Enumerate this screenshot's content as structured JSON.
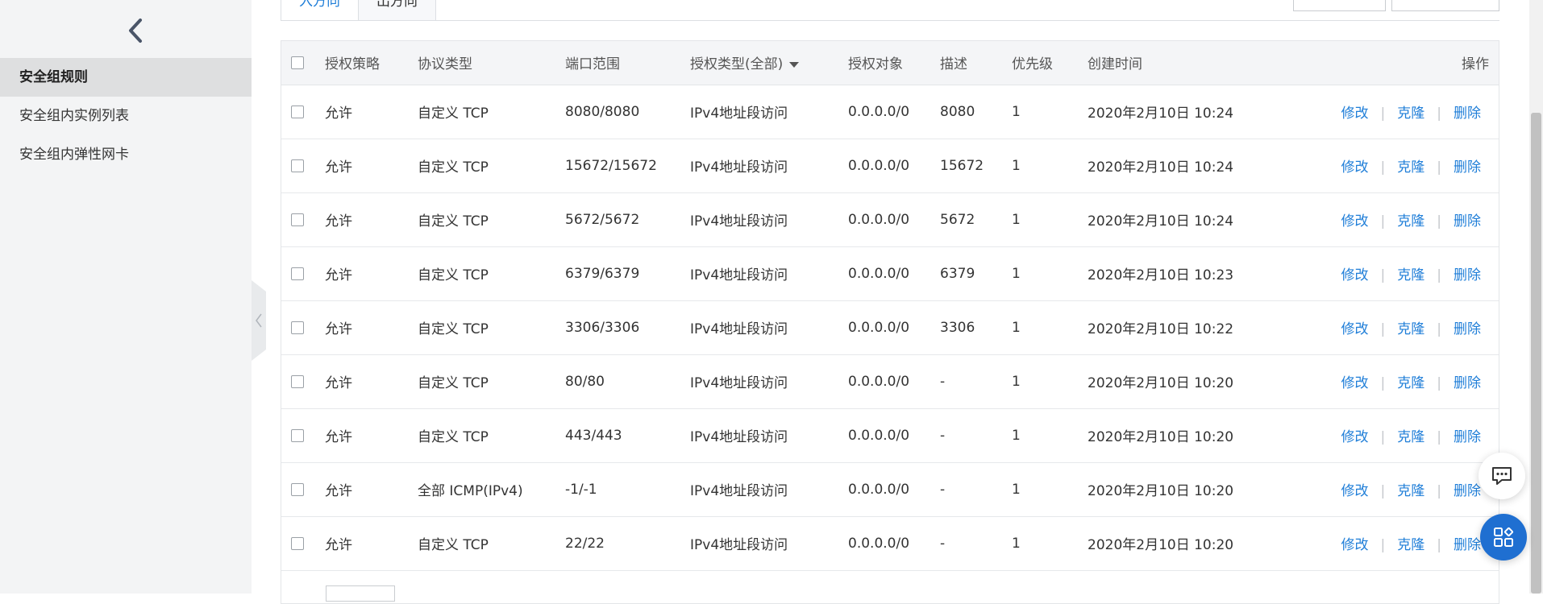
{
  "sidebar": {
    "items": [
      {
        "label": "安全组规则",
        "active": true
      },
      {
        "label": "安全组内实例列表",
        "active": false
      },
      {
        "label": "安全组内弹性网卡",
        "active": false
      }
    ]
  },
  "tabs": [
    {
      "label": "入方向"
    },
    {
      "label": "出方向"
    }
  ],
  "table": {
    "headers": {
      "policy": "授权策略",
      "protocol": "协议类型",
      "port": "端口范围",
      "auth_type": "授权类型(全部)",
      "auth_obj": "授权对象",
      "desc": "描述",
      "priority": "优先级",
      "created": "创建时间",
      "ops": "操作"
    },
    "actions": {
      "edit": "修改",
      "clone": "克隆",
      "delete": "删除",
      "sep": "|"
    },
    "rows": [
      {
        "policy": "允许",
        "protocol": "自定义 TCP",
        "port": "8080/8080",
        "auth_type": "IPv4地址段访问",
        "auth_obj": "0.0.0.0/0",
        "desc": "8080",
        "priority": "1",
        "created": "2020年2月10日 10:24"
      },
      {
        "policy": "允许",
        "protocol": "自定义 TCP",
        "port": "15672/15672",
        "auth_type": "IPv4地址段访问",
        "auth_obj": "0.0.0.0/0",
        "desc": "15672",
        "priority": "1",
        "created": "2020年2月10日 10:24"
      },
      {
        "policy": "允许",
        "protocol": "自定义 TCP",
        "port": "5672/5672",
        "auth_type": "IPv4地址段访问",
        "auth_obj": "0.0.0.0/0",
        "desc": "5672",
        "priority": "1",
        "created": "2020年2月10日 10:24"
      },
      {
        "policy": "允许",
        "protocol": "自定义 TCP",
        "port": "6379/6379",
        "auth_type": "IPv4地址段访问",
        "auth_obj": "0.0.0.0/0",
        "desc": "6379",
        "priority": "1",
        "created": "2020年2月10日 10:23"
      },
      {
        "policy": "允许",
        "protocol": "自定义 TCP",
        "port": "3306/3306",
        "auth_type": "IPv4地址段访问",
        "auth_obj": "0.0.0.0/0",
        "desc": "3306",
        "priority": "1",
        "created": "2020年2月10日 10:22"
      },
      {
        "policy": "允许",
        "protocol": "自定义 TCP",
        "port": "80/80",
        "auth_type": "IPv4地址段访问",
        "auth_obj": "0.0.0.0/0",
        "desc": "-",
        "priority": "1",
        "created": "2020年2月10日 10:20"
      },
      {
        "policy": "允许",
        "protocol": "自定义 TCP",
        "port": "443/443",
        "auth_type": "IPv4地址段访问",
        "auth_obj": "0.0.0.0/0",
        "desc": "-",
        "priority": "1",
        "created": "2020年2月10日 10:20"
      },
      {
        "policy": "允许",
        "protocol": "全部 ICMP(IPv4)",
        "port": "-1/-1",
        "auth_type": "IPv4地址段访问",
        "auth_obj": "0.0.0.0/0",
        "desc": "-",
        "priority": "1",
        "created": "2020年2月10日 10:20"
      },
      {
        "policy": "允许",
        "protocol": "自定义 TCP",
        "port": "22/22",
        "auth_type": "IPv4地址段访问",
        "auth_obj": "0.0.0.0/0",
        "desc": "-",
        "priority": "1",
        "created": "2020年2月10日 10:20"
      }
    ]
  },
  "icons": {
    "back": "chevron-left-icon",
    "collapse": "chevron-left-icon",
    "sort": "caret-down-icon",
    "chat": "chat-icon",
    "apps": "apps-icon"
  },
  "colors": {
    "accent": "#ff6a00",
    "link": "#1f7ed8",
    "float_button": "#1f6fd1"
  }
}
